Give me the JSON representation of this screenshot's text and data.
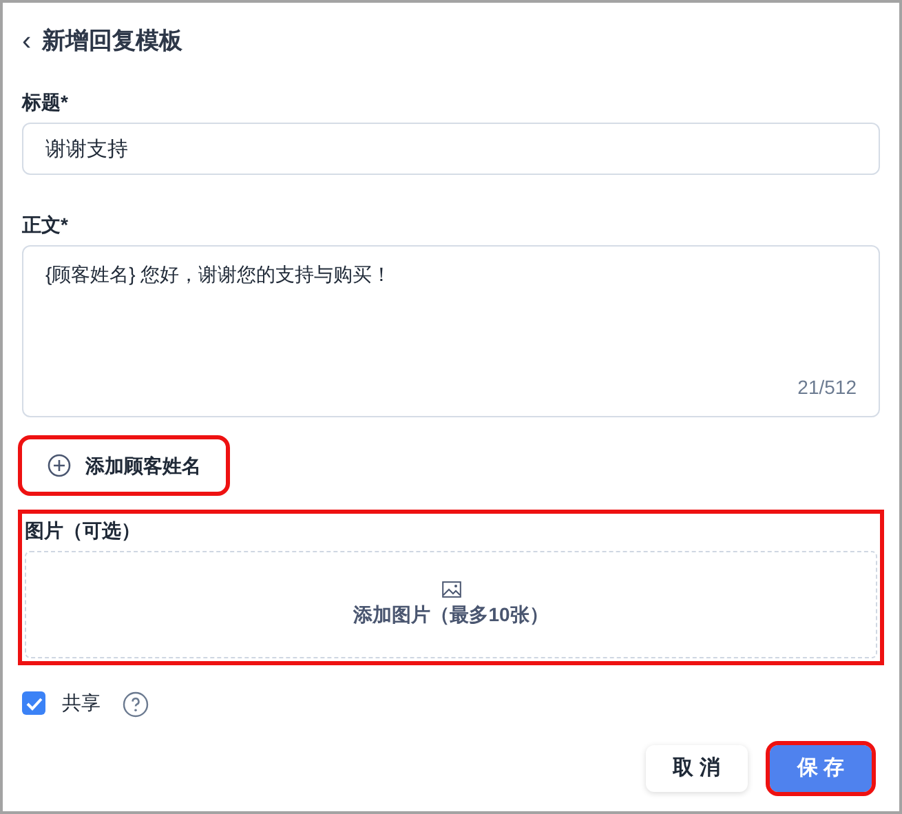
{
  "header": {
    "back_icon": "‹",
    "title": "新增回复模板"
  },
  "title_field": {
    "label": "标题*",
    "value": "谢谢支持"
  },
  "body_field": {
    "label": "正文*",
    "value": "{顾客姓名} 您好，谢谢您的支持与购买！",
    "counter": "21/512"
  },
  "insert_button": {
    "label": "添加顾客姓名",
    "highlighted": true
  },
  "image_section": {
    "label": "图片（可选）",
    "upload_text": "添加图片（最多10张）",
    "highlighted": true
  },
  "share": {
    "label": "共享",
    "checked": true
  },
  "buttons": [
    {
      "label": "取 消",
      "kind": "secondary",
      "highlighted": false
    },
    {
      "label": "保 存",
      "kind": "primary",
      "highlighted": true
    }
  ]
}
